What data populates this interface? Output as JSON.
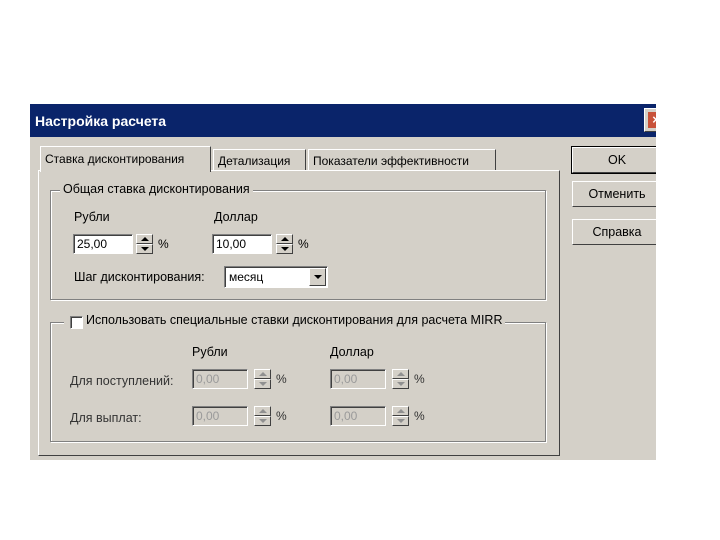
{
  "window": {
    "title": "Настройка расчета"
  },
  "tabs": [
    {
      "label": "Ставка дисконтирования"
    },
    {
      "label": "Детализация"
    },
    {
      "label": "Показатели эффективности"
    }
  ],
  "buttons": {
    "ok": "OK",
    "cancel": "Отменить",
    "help": "Справка"
  },
  "general_rate": {
    "legend": "Общая ставка дисконтирования",
    "rubles_label": "Рубли",
    "dollar_label": "Доллар",
    "rubles_value": "25,00",
    "dollar_value": "10,00",
    "percent": "%",
    "step_label": "Шаг дисконтирования:",
    "step_value": "месяц"
  },
  "mirr": {
    "checkbox_label": "Использовать специальные ставки дисконтирования для расчета MIRR",
    "checked": false,
    "rubles_label": "Рубли",
    "dollar_label": "Доллар",
    "inflows_label": "Для поступлений:",
    "outflows_label": "Для выплат:",
    "inflows_rubles": "0,00",
    "inflows_dollar": "0,00",
    "outflows_rubles": "0,00",
    "outflows_dollar": "0,00",
    "percent": "%"
  },
  "colors": {
    "titlebar": "#0a246a",
    "face": "#d4d0c8",
    "close": "#c8523a"
  }
}
